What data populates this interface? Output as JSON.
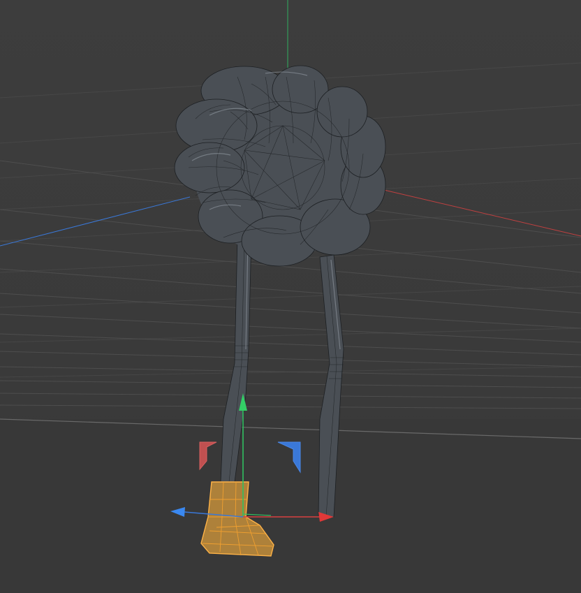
{
  "viewport": {
    "background": "#3b3b3b",
    "grid_color": "#505050",
    "horizon_color": "#666666"
  },
  "axes": {
    "x_color": "#d04040",
    "y_color": "#30b060",
    "z_color": "#3a78d8"
  },
  "objects": [
    {
      "name": "flower-head-mesh",
      "selected": false
    },
    {
      "name": "left-leg-mesh",
      "selected": false
    },
    {
      "name": "right-leg-mesh",
      "selected": false
    },
    {
      "name": "boot-mesh",
      "selected": true
    }
  ],
  "colors": {
    "mesh": "#4a4f55",
    "wireframe": "#1c1f22",
    "selection": "#ffa833"
  },
  "gizmo": {
    "mode": "move",
    "icons": [
      "move-x-arrow-icon",
      "move-y-arrow-icon",
      "move-z-arrow-icon",
      "scale-handle-icon"
    ]
  }
}
